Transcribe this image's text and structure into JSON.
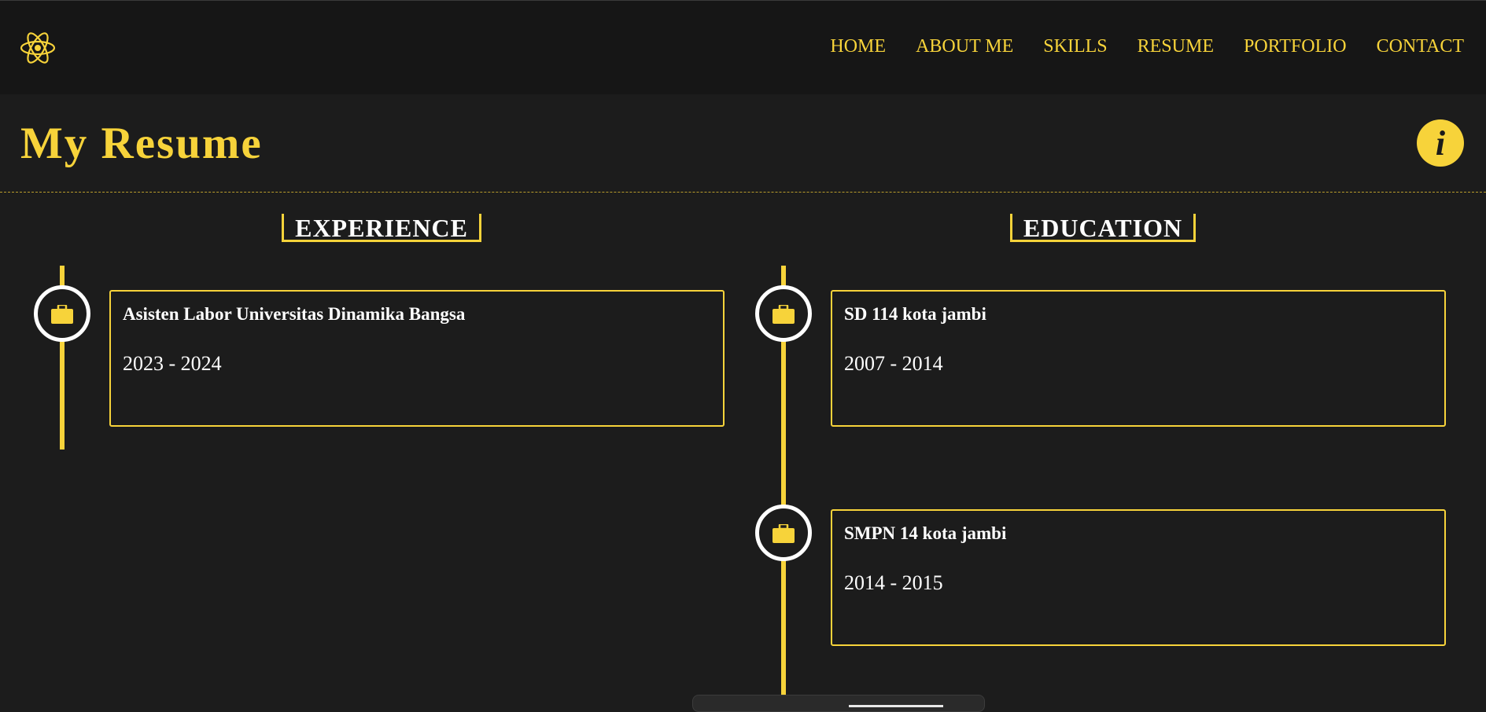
{
  "nav": {
    "logo_icon": "react-atom-icon",
    "links": [
      "HOME",
      "ABOUT ME",
      "SKILLS",
      "RESUME",
      "PORTFOLIO",
      "CONTACT"
    ]
  },
  "header": {
    "title": "My Resume",
    "info_glyph": "i"
  },
  "experience": {
    "heading": "EXPERIENCE",
    "items": [
      {
        "title": "Asisten Labor Universitas Dinamika Bangsa",
        "date": "2023 - 2024",
        "icon": "briefcase-icon"
      }
    ]
  },
  "education": {
    "heading": "EDUCATION",
    "items": [
      {
        "title": "SD 114 kota jambi",
        "date": "2007 - 2014",
        "icon": "briefcase-icon"
      },
      {
        "title": "SMPN 14 kota jambi",
        "date": "2014 - 2015",
        "icon": "briefcase-icon"
      }
    ]
  },
  "colors": {
    "accent": "#f7d33a",
    "background": "#1c1c1c",
    "navbar": "#161616",
    "text": "#ffffff"
  }
}
